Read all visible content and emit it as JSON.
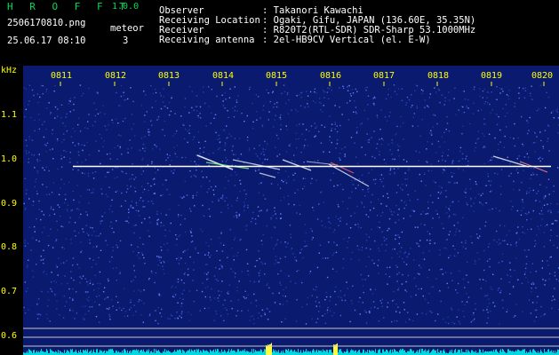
{
  "app": {
    "name": "H R O F F T",
    "version": "1.0.0"
  },
  "file": {
    "filename": "2506170810.png",
    "datetime": "25.06.17 08:10"
  },
  "meteor": {
    "label": "meteor",
    "count": "3"
  },
  "info": {
    "observer_label": "Observer",
    "observer_value": ": Takanori Kawachi",
    "location_label": "Receiving Location",
    "location_value": ": Ogaki, Gifu, JAPAN (136.60E, 35.35N)",
    "receiver_label": "Receiver",
    "receiver_value": ": R820T2(RTL-SDR) SDR-Sharp 53.1000MHz",
    "antenna_label": "Receiving antenna",
    "antenna_value": ": 2el-HB9CV Vertical (el. E-W)"
  },
  "y_axis": {
    "unit": "kHz",
    "ticks": [
      "1.1",
      "1.0",
      "0.9",
      "0.8",
      "0.7",
      "0.6"
    ]
  },
  "x_axis": {
    "ticks": [
      "0811",
      "0812",
      "0813",
      "0814",
      "0815",
      "0816",
      "0817",
      "0818",
      "0819",
      "0820"
    ]
  },
  "colors": {
    "background": "#000000",
    "noise": "#0a1a6e",
    "signal": "#ffffff",
    "text": "#ffff00",
    "accent": "#00dd55",
    "level": "#00d8e0"
  }
}
